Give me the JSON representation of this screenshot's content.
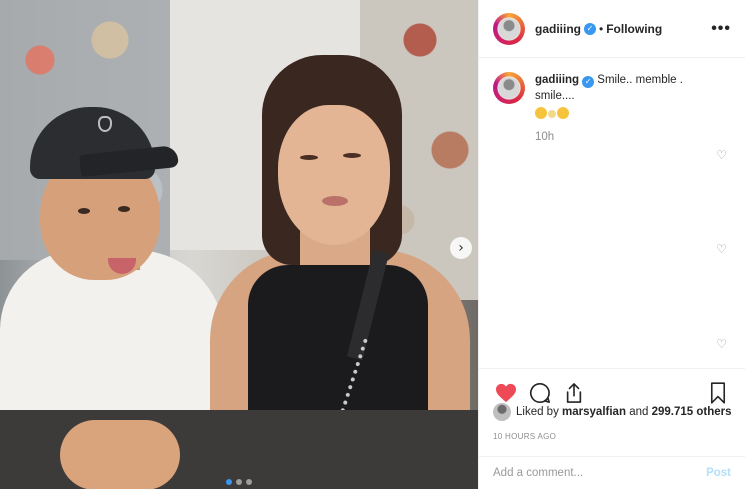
{
  "post": {
    "author": "gadiiing",
    "separator": "•",
    "follow_status": "Following",
    "more_label": "•••",
    "next_glyph": "›",
    "carousel": {
      "count": 3,
      "active_index": 1
    }
  },
  "caption": {
    "author": "gadiiing",
    "text": "Smile.. memble . smile....",
    "time": "10h"
  },
  "comment_like_icons": [
    "heart-outline-icon",
    "heart-outline-icon",
    "heart-outline-icon"
  ],
  "actions": {
    "liked": true,
    "like_icon": "heart-filled-icon",
    "comment_icon": "comment-icon",
    "share_icon": "share-icon",
    "save_icon": "bookmark-icon"
  },
  "likes": {
    "prefix": "Liked by",
    "user": "marsyalfian",
    "connector": "and",
    "others": "299.715 others"
  },
  "timestamp": "10 HOURS AGO",
  "comment_box": {
    "placeholder": "Add a comment...",
    "post_label": "Post"
  },
  "colors": {
    "like_red": "#ed4956",
    "verified_blue": "#3897f0",
    "post_disabled": "#b2dffc",
    "muted": "#8e8e8e"
  }
}
